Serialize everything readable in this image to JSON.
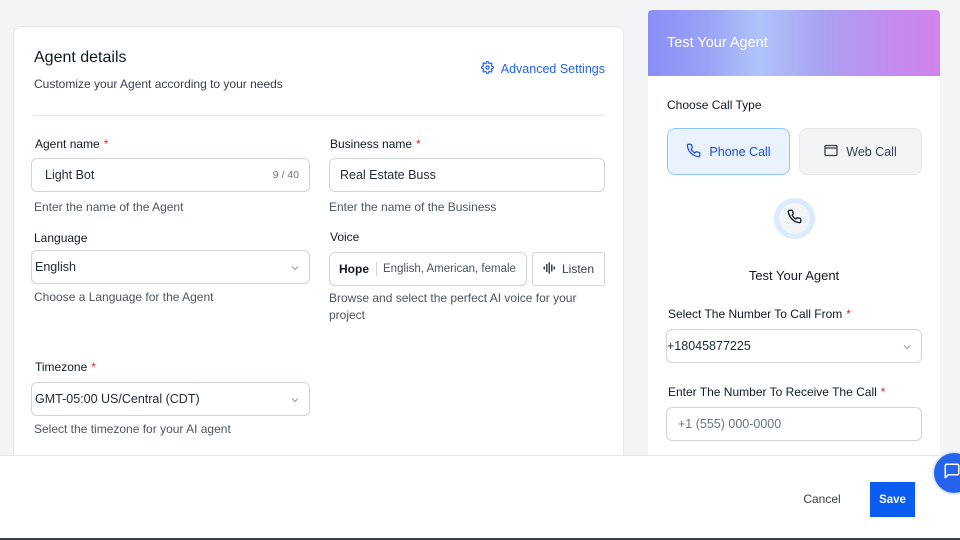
{
  "agent_details": {
    "title": "Agent details",
    "subtitle": "Customize your Agent according to your needs",
    "advanced_settings": "Advanced Settings",
    "agent_name": {
      "label": "Agent name",
      "value": "Light Bot",
      "counter": "9 / 40",
      "help": "Enter the name of the Agent"
    },
    "business_name": {
      "label": "Business name",
      "value": "Real Estate Buss",
      "help": "Enter the name of the Business"
    },
    "language": {
      "label": "Language",
      "value": "English",
      "help": "Choose a Language for the Agent"
    },
    "voice": {
      "label": "Voice",
      "name": "Hope",
      "description": "English, American, female",
      "listen": "Listen",
      "help": "Browse and select the perfect AI voice for your project"
    },
    "timezone": {
      "label": "Timezone",
      "value": "GMT-05:00 US/Central (CDT)",
      "help": "Select the timezone for your AI agent"
    }
  },
  "test_panel": {
    "title": "Test Your Agent",
    "call_type_label": "Choose Call Type",
    "phone_call": "Phone Call",
    "web_call": "Web Call",
    "test_title": "Test Your Agent",
    "from_label": "Select The Number To Call From",
    "from_value": "+18045877225",
    "to_label": "Enter The Number To Receive The Call",
    "to_placeholder": "+1 (555) 000-0000"
  },
  "footer": {
    "cancel": "Cancel",
    "save": "Save"
  },
  "required_mark": "*",
  "colors": {
    "primary": "#0b5cf0",
    "link": "#2563eb",
    "required": "#dc2626"
  },
  "icons": [
    "gear-icon",
    "chevron-down-icon",
    "waveform-icon",
    "phone-icon",
    "monitor-icon",
    "chat-icon"
  ]
}
